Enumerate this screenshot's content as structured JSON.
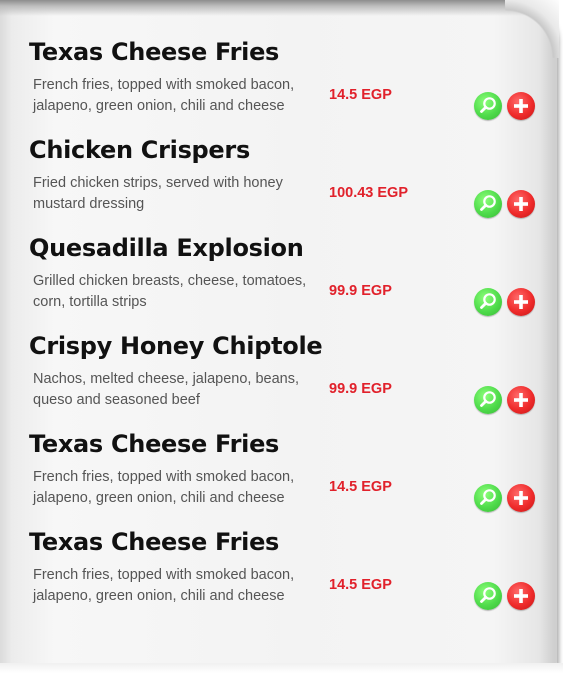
{
  "menu": {
    "items": [
      {
        "title": "Texas Cheese Fries",
        "description": "French fries, topped with smoked bacon, jalapeno, green onion, chili and cheese",
        "price": "14.5 EGP"
      },
      {
        "title": "Chicken Crispers",
        "description": "Fried chicken strips, served with honey mustard dressing",
        "price": "100.43 EGP"
      },
      {
        "title": "Quesadilla Explosion",
        "description": "Grilled chicken breasts, cheese, tomatoes, corn, tortilla strips",
        "price": "99.9 EGP"
      },
      {
        "title": "Crispy Honey Chiptole",
        "description": "Nachos, melted cheese, jalapeno, beans, queso and seasoned beef",
        "price": "99.9 EGP"
      },
      {
        "title": "Texas Cheese Fries",
        "description": "French fries, topped with smoked bacon, jalapeno, green onion, chili and cheese",
        "price": "14.5 EGP"
      },
      {
        "title": "Texas Cheese Fries",
        "description": "French fries, topped with smoked bacon, jalapeno, green onion, chili and cheese",
        "price": "14.5 EGP"
      }
    ],
    "icons": {
      "view": "magnifier-icon",
      "add": "plus-icon"
    },
    "colors": {
      "title": "#111111",
      "description": "#555555",
      "price": "#e1212b",
      "view_button": "#4fdb4b",
      "add_button": "#ef2b2b"
    }
  }
}
